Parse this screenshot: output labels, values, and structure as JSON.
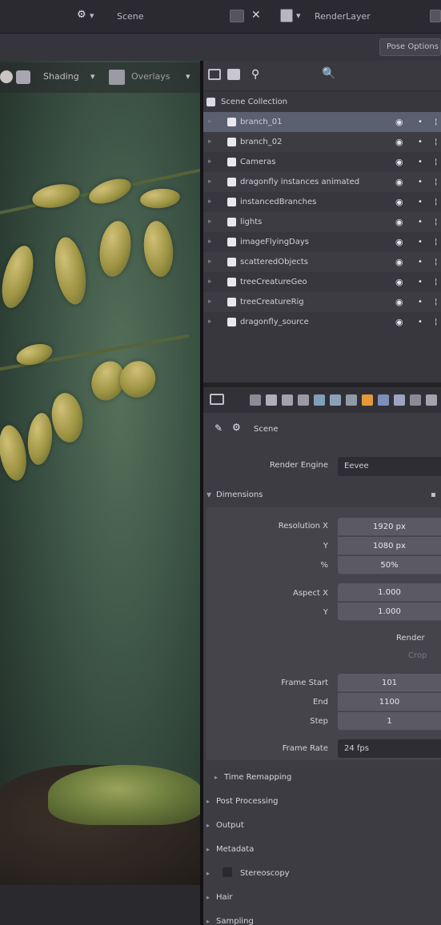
{
  "topbar": {
    "scene_icon": "scene-icon",
    "scene_label": "Scene",
    "layer_label": "RenderLayer"
  },
  "viewport": {
    "shading_label": "Shading",
    "overlays_label": "Overlays"
  },
  "pose_options": "Pose Options",
  "outliner": {
    "collection_label": "Scene Collection",
    "items": [
      {
        "label": "branch_01",
        "selected": true
      },
      {
        "label": "branch_02",
        "selected": false
      },
      {
        "label": "Cameras",
        "selected": false
      },
      {
        "label": "dragonfly instances animated",
        "selected": false
      },
      {
        "label": "instancedBranches",
        "selected": false
      },
      {
        "label": "lights",
        "selected": false
      },
      {
        "label": "imageFlyingDays",
        "selected": false
      },
      {
        "label": "scatteredObjects",
        "selected": false
      },
      {
        "label": "treeCreatureGeo",
        "selected": false
      },
      {
        "label": "treeCreatureRig",
        "selected": false
      },
      {
        "label": "dragonfly_source",
        "selected": false
      }
    ]
  },
  "properties": {
    "scene_label": "Scene",
    "render_engine_label": "Render Engine",
    "render_engine_value": "Eevee",
    "dimensions_label": "Dimensions",
    "resolution_x_label": "Resolution X",
    "resolution_x_value": "1920 px",
    "resolution_y_label": "Y",
    "resolution_y_value": "1080 px",
    "resolution_pct_label": "%",
    "resolution_pct_value": "50%",
    "aspect_x_label": "Aspect X",
    "aspect_x_value": "1.000",
    "aspect_y_label": "Y",
    "aspect_y_value": "1.000",
    "render_label": "Render",
    "crop_label": "Crop",
    "frame_start_label": "Frame Start",
    "frame_start_value": "101",
    "end_label": "End",
    "end_value": "1100",
    "step_label": "Step",
    "step_value": "1",
    "frame_rate_label": "Frame Rate",
    "frame_rate_value": "24 fps",
    "sections": [
      "Time Remapping",
      "Post Processing",
      "Output",
      "Metadata",
      "Stereoscopy",
      "Hair",
      "Sampling"
    ]
  },
  "colors": {
    "selection": "#5a6070",
    "accent": "#e29a3a"
  }
}
